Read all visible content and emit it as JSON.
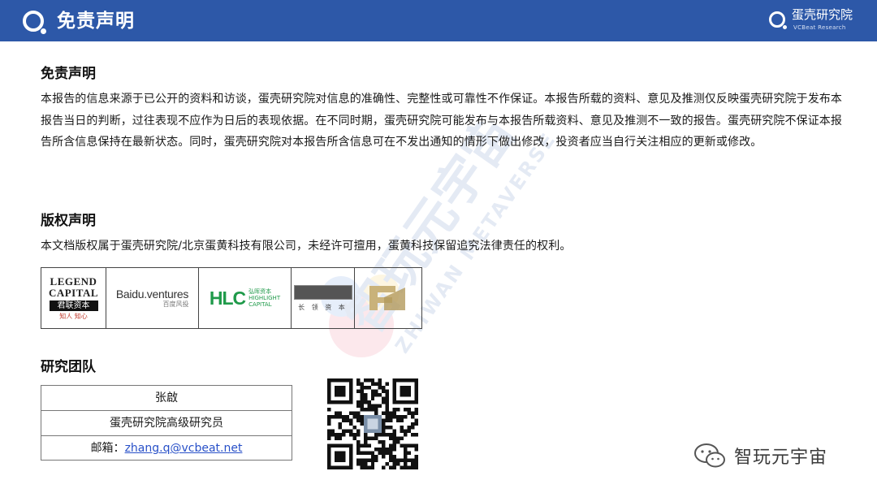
{
  "header": {
    "title": "免责声明",
    "brand_name": "蛋壳研究院",
    "brand_sub": "VCBeat Research"
  },
  "sections": {
    "disclaimer": {
      "title": "免责声明",
      "body": "本报告的信息来源于已公开的资料和访谈，蛋壳研究院对信息的准确性、完整性或可靠性不作保证。本报告所载的资料、意见及推测仅反映蛋壳研究院于发布本报告当日的判断，过往表现不应作为日后的表现依据。在不同时期，蛋壳研究院可能发布与本报告所载资料、意见及推测不一致的报告。蛋壳研究院不保证本报告所含信息保持在最新状态。同时，蛋壳研究院对本报告所含信息可在不发出通知的情形下做出修改，投资者应当自行关注相应的更新或修改。"
    },
    "copyright": {
      "title": "版权声明",
      "body": "本文档版权属于蛋壳研究院/北京蛋黄科技有限公司，未经许可擅用，蛋黄科技保留追究法律责任的权利。"
    },
    "team": {
      "title": "研究团队"
    }
  },
  "investor_logos": {
    "legend": {
      "line1": "LEGEND",
      "line2": "CAPITAL",
      "cn": "君联资本",
      "tagline": "知人 知心"
    },
    "baidu": {
      "name": "Baidu.ventures",
      "cn": "百度风投"
    },
    "hlc": {
      "mark": "HLC",
      "cn": "弘晖资本",
      "en": "HIGHLIGHT",
      "en2": "CAPITAL"
    },
    "changling": {
      "cn": "长 领 资 本"
    }
  },
  "team": {
    "name": "张啟",
    "role": "蛋壳研究院高级研究员",
    "email_label": "邮箱：",
    "email": "zhang.q@vcbeat.net"
  },
  "watermark": {
    "cn": "智玩元宇宙",
    "en": "ZHIWAN METAVERSE"
  },
  "wechat": {
    "account": "智玩元宇宙"
  },
  "colors": {
    "header_bg": "#2d58a8",
    "link": "#2850c8",
    "hlc_green": "#1f9a4a"
  }
}
